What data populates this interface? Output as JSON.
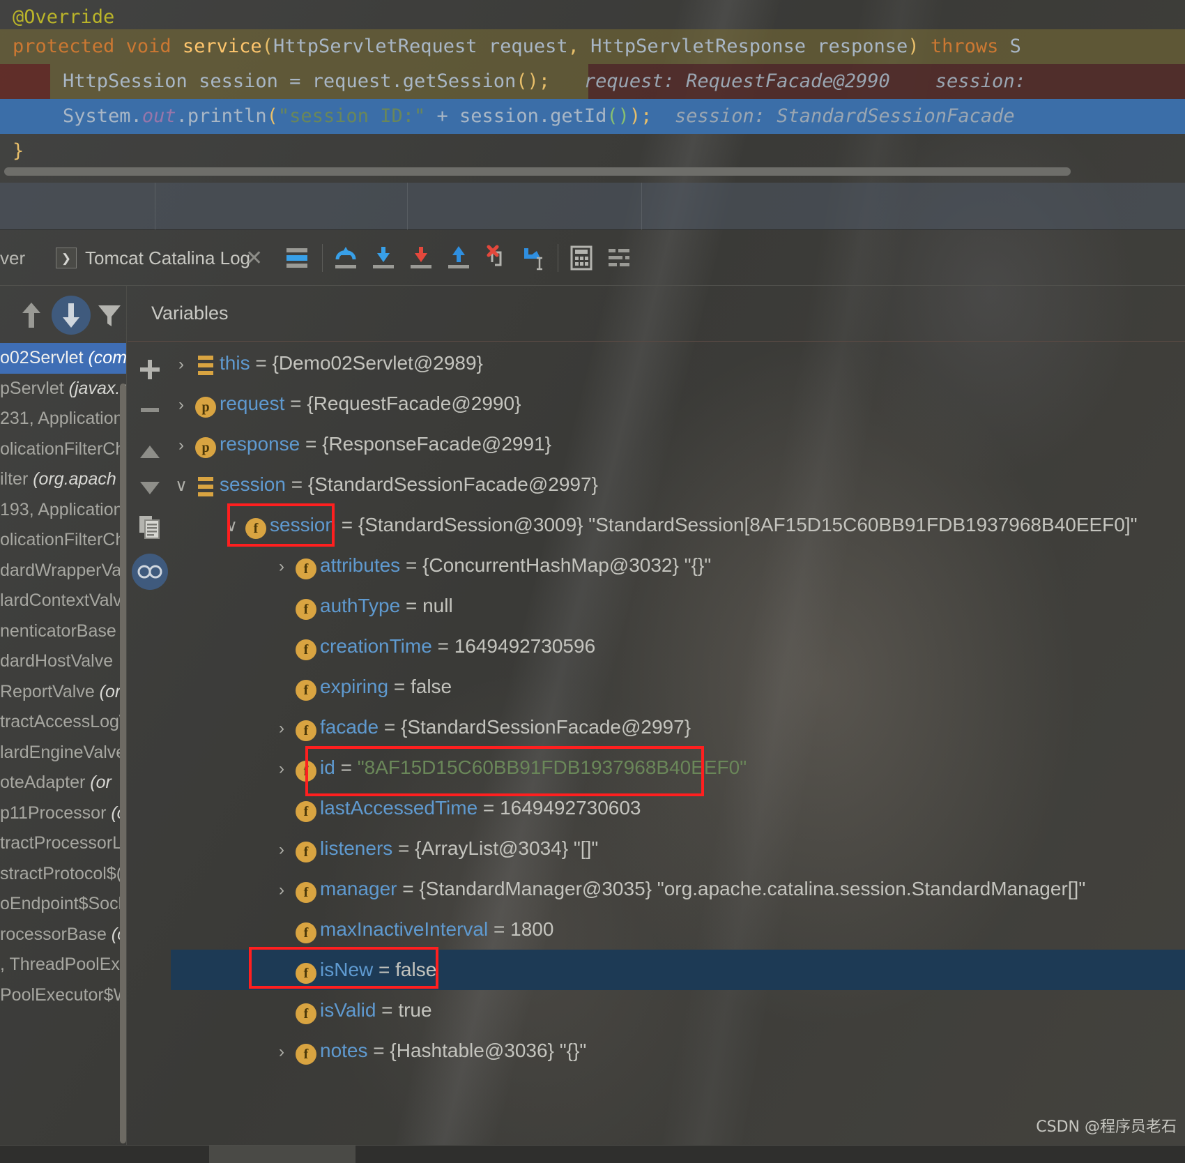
{
  "editor": {
    "lines": [
      {
        "id": "annotation",
        "text": "@Override"
      },
      {
        "id": "signature",
        "text": "protected void service(HttpServletRequest request, HttpServletResponse response) throws S"
      },
      {
        "id": "get-session",
        "text": "HttpSession session = request.getSession();",
        "hint": "request: RequestFacade@2990      session:"
      },
      {
        "id": "println",
        "text": "System.out.println(\"session ID:\" + session.getId());",
        "hint": "session: StandardSessionFacade"
      },
      {
        "id": "close-brace",
        "text": "}"
      }
    ],
    "tokens": {
      "annotation": "@Override",
      "protected": "protected",
      "void": "void",
      "service": "service",
      "arg_request_type": "HttpServletRequest",
      "arg_request_name": "request",
      "arg_response_type": "HttpServletResponse",
      "arg_response_name": "response",
      "throws": "throws",
      "throws_tail": "S",
      "httpsession": "HttpSession",
      "session_var": "session",
      "assign": "=",
      "request_call": "request.getSession",
      "system": "System",
      "out": "out",
      "println": "println",
      "string_literal": "\"session ID:\"",
      "plus": "+",
      "session_getid": "session.getId"
    },
    "inlay_request": "request: RequestFacade@2990",
    "inlay_session_partial": "session:",
    "inlay_session": "session: StandardSessionFacade"
  },
  "toolbar": {
    "left_label": "ver",
    "console_tab_label": "Tomcat Catalina Log",
    "console_tab_chip": "❯",
    "close_label": "✕",
    "buttons": [
      {
        "name": "show-execution-point",
        "label": "Show Execution Point"
      },
      {
        "name": "step-over",
        "label": "Step Over"
      },
      {
        "name": "step-into",
        "label": "Step Into"
      },
      {
        "name": "force-step-into",
        "label": "Force Step Into"
      },
      {
        "name": "step-out",
        "label": "Step Out"
      },
      {
        "name": "drop-frame",
        "label": "Drop Frame"
      },
      {
        "name": "run-to-cursor",
        "label": "Run to Cursor"
      },
      {
        "name": "evaluate-expression",
        "label": "Evaluate Expression"
      },
      {
        "name": "settings",
        "label": "Layout Settings"
      }
    ]
  },
  "frames": {
    "toolbar": [
      {
        "name": "thread-up",
        "label": "Previous Frame"
      },
      {
        "name": "thread-down",
        "label": "Next Frame"
      },
      {
        "name": "filter",
        "label": "Filter"
      }
    ],
    "rows": [
      {
        "text": "o02Servlet ",
        "italic": "(com",
        "selected": true
      },
      {
        "text": "pServlet ",
        "italic": "(javax.s",
        "selected": false
      },
      {
        "text": "231, Application",
        "italic": "",
        "selected": false
      },
      {
        "text": "olicationFilterCh",
        "italic": "",
        "selected": false
      },
      {
        "text": "ilter ",
        "italic": "(org.apach",
        "selected": false
      },
      {
        "text": "193, Application",
        "italic": "",
        "selected": false
      },
      {
        "text": "olicationFilterCh",
        "italic": "",
        "selected": false
      },
      {
        "text": "dardWrapperVa",
        "italic": "",
        "selected": false
      },
      {
        "text": "lardContextValv",
        "italic": "",
        "selected": false
      },
      {
        "text": "nenticatorBase ",
        "italic": "(",
        "selected": false
      },
      {
        "text": "dardHostValve",
        "italic": "",
        "selected": false
      },
      {
        "text": "ReportValve ",
        "italic": "(or",
        "selected": false
      },
      {
        "text": "tractAccessLog\\",
        "italic": "",
        "selected": false
      },
      {
        "text": "lardEngineValve",
        "italic": "",
        "selected": false
      },
      {
        "text": "oteAdapter ",
        "italic": "(or",
        "selected": false
      },
      {
        "text": "p11Processor ",
        "italic": "(o",
        "selected": false
      },
      {
        "text": "tractProcessorLi",
        "italic": "",
        "selected": false
      },
      {
        "text": "stractProtocol$(",
        "italic": "",
        "selected": false
      },
      {
        "text": "oEndpoint$Sock",
        "italic": "",
        "selected": false
      },
      {
        "text": "rocessorBase ",
        "italic": "(o",
        "selected": false
      },
      {
        "text": ", ThreadPoolExe",
        "italic": "",
        "selected": false
      },
      {
        "text": "PoolExecutor$W",
        "italic": "",
        "selected": false
      }
    ]
  },
  "variables": {
    "title": "Variables",
    "side_buttons": [
      {
        "name": "add-watch",
        "label": "+"
      },
      {
        "name": "remove-watch",
        "label": "−"
      },
      {
        "name": "move-up",
        "label": "▲"
      },
      {
        "name": "move-down",
        "label": "▼"
      },
      {
        "name": "copy-value",
        "label": "copy"
      },
      {
        "name": "inspect",
        "label": "inspect"
      }
    ],
    "rows": [
      {
        "indent": 0,
        "twisty": "collapsed",
        "icon": "fields",
        "name": "this",
        "value": " = {Demo02Servlet@2989}",
        "str": ""
      },
      {
        "indent": 0,
        "twisty": "collapsed",
        "icon": "p",
        "name": "request",
        "value": " = {RequestFacade@2990}",
        "str": ""
      },
      {
        "indent": 0,
        "twisty": "collapsed",
        "icon": "p",
        "name": "response",
        "value": " = {ResponseFacade@2991}",
        "str": ""
      },
      {
        "indent": 0,
        "twisty": "expanded",
        "icon": "fields",
        "name": "session",
        "value": " = {StandardSessionFacade@2997}",
        "str": ""
      },
      {
        "indent": 1,
        "twisty": "expanded",
        "icon": "f",
        "name": "session",
        "value": " = {StandardSession@3009} ",
        "str": "\"StandardSession[8AF15D15C60BB91FDB1937968B40EEF0]\""
      },
      {
        "indent": 2,
        "twisty": "collapsed",
        "icon": "f",
        "name": "attributes",
        "value": " = {ConcurrentHashMap@3032} ",
        "str": "\"{}\""
      },
      {
        "indent": 2,
        "twisty": "none",
        "icon": "f",
        "name": "authType",
        "value": " = null",
        "str": ""
      },
      {
        "indent": 2,
        "twisty": "none",
        "icon": "f",
        "name": "creationTime",
        "value": " = 1649492730596",
        "str": ""
      },
      {
        "indent": 2,
        "twisty": "none",
        "icon": "f",
        "name": "expiring",
        "value": " = false",
        "str": ""
      },
      {
        "indent": 2,
        "twisty": "collapsed",
        "icon": "f",
        "name": "facade",
        "value": " = {StandardSessionFacade@2997}",
        "str": ""
      },
      {
        "indent": 2,
        "twisty": "collapsed",
        "icon": "f",
        "name": "id",
        "value": " = ",
        "str": "\"8AF15D15C60BB91FDB1937968B40EEF0\""
      },
      {
        "indent": 2,
        "twisty": "none",
        "icon": "f",
        "name": "lastAccessedTime",
        "value": " = 1649492730603",
        "str": ""
      },
      {
        "indent": 2,
        "twisty": "collapsed",
        "icon": "f",
        "name": "listeners",
        "value": " = {ArrayList@3034} ",
        "str": "\"[]\""
      },
      {
        "indent": 2,
        "twisty": "collapsed",
        "icon": "f",
        "name": "manager",
        "value": " = {StandardManager@3035} ",
        "str": "\"org.apache.catalina.session.StandardManager[]\""
      },
      {
        "indent": 2,
        "twisty": "none",
        "icon": "f",
        "name": "maxInactiveInterval",
        "value": " = 1800",
        "str": ""
      },
      {
        "indent": 2,
        "twisty": "none",
        "icon": "f",
        "name": "isNew",
        "value": " = false",
        "str": "",
        "selected": true
      },
      {
        "indent": 2,
        "twisty": "none",
        "icon": "f",
        "name": "isValid",
        "value": " = true",
        "str": ""
      },
      {
        "indent": 2,
        "twisty": "collapsed",
        "icon": "f",
        "name": "notes",
        "value": " = {Hashtable@3036} ",
        "str": "\"{}\""
      }
    ]
  },
  "annotations": {
    "highlight_boxes": [
      {
        "name": "session-name-highlight"
      },
      {
        "name": "id-value-highlight"
      },
      {
        "name": "isnew-highlight"
      }
    ]
  },
  "watermark": "CSDN @程序员老石",
  "colors": {
    "accent_blue": "#3f6eb5",
    "field_badge": "#d9a441",
    "string_green": "#6a8759",
    "highlight_red": "#ff1f1f",
    "selected_row": "#1d3a55"
  }
}
